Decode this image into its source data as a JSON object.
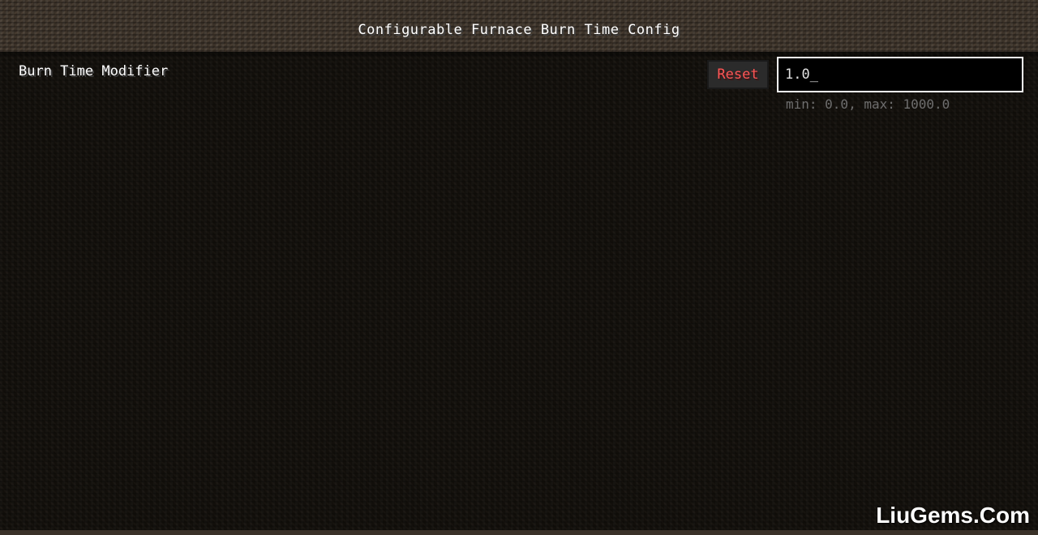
{
  "header": {
    "title": "Configurable Furnace Burn Time Config"
  },
  "entry": {
    "label": "Burn Time Modifier",
    "reset_label": "Reset",
    "value": "1.0_",
    "hint": "min: 0.0, max: 1000.0"
  },
  "watermark": "LiuGems.Com",
  "colors": {
    "reset_text": "#ff5555",
    "input_border": "#ffffff",
    "hint_text": "#6e6e6e"
  }
}
